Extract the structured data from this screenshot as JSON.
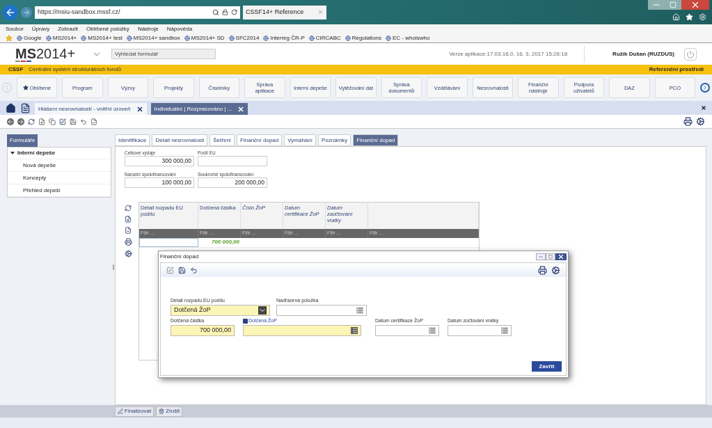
{
  "browser": {
    "address": "https://msiu-sandbox.mssf.cz/",
    "tab_title": "CSSF14+ Reference"
  },
  "menu": [
    "Soubor",
    "Úpravy",
    "Zobrazit",
    "Oblíbené položky",
    "Nástroje",
    "Nápověda"
  ],
  "favorites": [
    "Google",
    "MS2014+",
    "MS2014+ test",
    "MS2014+ sandbox",
    "MS2014+ SD",
    "SFC2014",
    "Interreg ČR-P",
    "CIRCABC",
    "Regulations",
    "EC - whoiswho"
  ],
  "header": {
    "logo_bold": "MS",
    "logo_rest": "2014+",
    "search_placeholder": "Vyhledat formulář",
    "version": "Verze aplikace:17.03.16.0, 16. 3. 2017 15:26:18",
    "user": "Ružík Dušan (RUZDUS)"
  },
  "banner": {
    "code": "CSSF",
    "name": "Centrální systém strukturálních fondů",
    "environment": "Referenční prostředí"
  },
  "nav": [
    {
      "label": "Oblíbené",
      "kind": "favorite"
    },
    {
      "label": "Program",
      "kind": "plain"
    },
    {
      "label": "Výzvy",
      "kind": "plain"
    },
    {
      "label": "Projekty",
      "kind": "plain"
    },
    {
      "label": "Číselníky",
      "kind": "plain"
    },
    {
      "label": "Správa aplikace",
      "kind": "plain"
    },
    {
      "label": "Interní depeše",
      "kind": "plain"
    },
    {
      "label": "Vytěžování dat",
      "kind": "plain"
    },
    {
      "label": "Správa dokumentů",
      "kind": "plain"
    },
    {
      "label": "Vzdělávání",
      "kind": "plain"
    },
    {
      "label": "Nesrovnalosti",
      "kind": "plain"
    },
    {
      "label": "Finanční nástroje",
      "kind": "plain"
    },
    {
      "label": "Podpora uživatelů",
      "kind": "plain"
    },
    {
      "label": "DAZ",
      "kind": "plain"
    },
    {
      "label": "PCO",
      "kind": "plain"
    }
  ],
  "doc_tabs": [
    {
      "label": "Hlášení nesrovnalostí - vnitřní úroveň",
      "selected": false
    },
    {
      "label": "Individuální | Rozpracováno | ...",
      "selected": true
    }
  ],
  "sidebar": {
    "title": "Formuláře",
    "items": [
      {
        "label": "Interní depeše",
        "expanded": true,
        "children": [
          {
            "label": "Nová depeše"
          },
          {
            "label": "Koncepty"
          },
          {
            "label": "Přehled depeší"
          }
        ]
      }
    ]
  },
  "form_tabs": [
    {
      "label": "Identifikace",
      "selected": false
    },
    {
      "label": "Detail nesrovnalosti",
      "selected": false
    },
    {
      "label": "Šetření",
      "selected": false
    },
    {
      "label": "Finanční dopad",
      "selected": false
    },
    {
      "label": "Vymáhání",
      "selected": false
    },
    {
      "label": "Poznámky",
      "selected": false
    },
    {
      "label": "Finanční dopad",
      "selected": true
    }
  ],
  "summary_fields": [
    {
      "label": "Celkové výdaje",
      "value": "300 000,00"
    },
    {
      "label": "Podíl EU"
    },
    {
      "label": "Národní spolufinancování",
      "value": "100 000,00"
    },
    {
      "label": "Soukromé spolufinancování",
      "value": "200 000,00"
    }
  ],
  "grid": {
    "columns": [
      {
        "label": "Detail rozpadu EU podílu",
        "italic": false,
        "filter": "Filtr ..."
      },
      {
        "label": "Dotčená částka",
        "italic": false,
        "filter": "Filtr ..."
      },
      {
        "label": "Číslo ŽoP",
        "italic": true,
        "filter": "Filtr ..."
      },
      {
        "label": "Datum certifikace ŽoP",
        "italic": true,
        "filter": "Filtr ..."
      },
      {
        "label": "Datum zaúčtování vratky",
        "italic": true,
        "filter": "Filtr ..."
      },
      {
        "filter": "Filtr ..."
      }
    ],
    "rows": [
      {
        "amount": "700 000,00"
      }
    ]
  },
  "dialog": {
    "title": "Finanční dopad",
    "rows": [
      [
        {
          "kind": "select",
          "label": "Detail rozpadu EU podílu",
          "value": "Dotčená ŽoP",
          "required": true,
          "info": false
        },
        {
          "kind": "lookup",
          "label": "Nadřazená položka",
          "required": false,
          "info": false
        }
      ],
      [
        {
          "kind": "amount",
          "label": "Dotčená částka",
          "value": "700 000,00",
          "required": true,
          "info": false
        },
        {
          "kind": "lookup",
          "label": "Dotčená ŽoP",
          "required": true,
          "info": true
        },
        {
          "kind": "lookup",
          "label": "Datum certifikace ŽoP",
          "required": false,
          "info": false
        },
        {
          "kind": "lookup",
          "label": "Datum zúčtování vratky",
          "required": false,
          "info": false
        }
      ]
    ],
    "close_button": "Zavřít"
  },
  "footer_buttons": [
    "Finalizovat",
    "Zrušit"
  ]
}
